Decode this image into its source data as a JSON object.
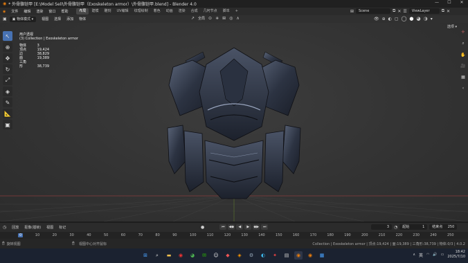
{
  "titlebar": {
    "title": "* 外骨骼铠甲 [E:\\Model Sell\\外骨骼铠甲（Exoskeleton armor）\\外骨骼铠甲.blend] - Blender 4.0"
  },
  "menubar": {
    "menus": [
      "文件",
      "编辑",
      "渲染",
      "窗口",
      "帮助"
    ],
    "workspaces": [
      "布局",
      "建模",
      "雕刻",
      "UV编辑",
      "纹理绘制",
      "着色",
      "动画",
      "渲染",
      "合成",
      "几何节点",
      "脚本"
    ],
    "scene": "Scene",
    "view_layer": "ViewLayer"
  },
  "header3d": {
    "mode": "物体模式",
    "menus": [
      "视图",
      "选择",
      "添加",
      "物体"
    ],
    "transform_orientation": "全局",
    "options_label": "选项"
  },
  "viewport": {
    "view_name": "用户透视",
    "collection_path": "(3) Collection | Exoskeleton armor",
    "stats": [
      {
        "label": "物体",
        "value": "3"
      },
      {
        "label": "顶点",
        "value": "19,424"
      },
      {
        "label": "边",
        "value": "38,829"
      },
      {
        "label": "面",
        "value": "19,389"
      },
      {
        "label": "三角形",
        "value": "38,739"
      }
    ],
    "toolbar_icons": [
      "select-box-icon",
      "cursor-icon",
      "move-icon",
      "rotate-icon",
      "scale-icon",
      "transform-icon",
      "annotate-icon",
      "measure-icon",
      "add-cube-icon"
    ]
  },
  "timeline": {
    "menus": [
      "回放",
      "抠像(插帧)",
      "视图",
      "标记"
    ],
    "current_frame": "3",
    "start_label": "起始",
    "start_value": "1",
    "end_label": "结束点",
    "end_value": "250",
    "ticks": [
      "0",
      "10",
      "20",
      "30",
      "40",
      "50",
      "60",
      "70",
      "80",
      "90",
      "100",
      "110",
      "120",
      "130",
      "140",
      "150",
      "160",
      "170",
      "180",
      "190",
      "200",
      "210",
      "220",
      "230",
      "240",
      "250"
    ]
  },
  "statusbar": {
    "left": "旋转视图",
    "middle": "视图中心对齐鼠标",
    "right": "Collection | Exoskeleton armor | 顶点:19,424 | 面:19,389 | 三角形:38,739 | 物体:0/3 | 4.0.2"
  },
  "taskbar": {
    "time": "18:42",
    "date": "2025/7/10",
    "lang": "英"
  },
  "colors": {
    "accent": "#4772b3",
    "viewport_bg": "#383838"
  }
}
